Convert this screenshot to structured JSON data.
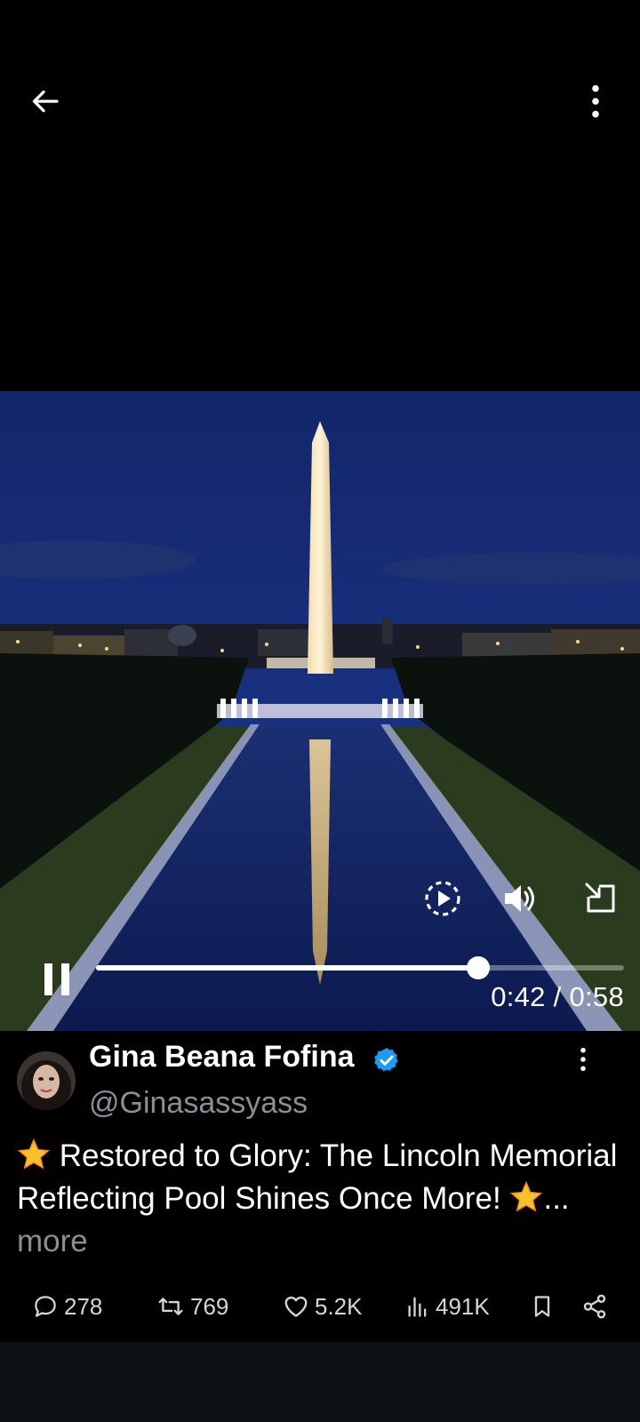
{
  "topbar": {
    "back_icon": "arrow-left-icon",
    "more_icon": "more-vertical-icon"
  },
  "video": {
    "current_time": "0:42",
    "duration": "0:58",
    "time_display": "0:42 / 0:58",
    "progress": 0.724,
    "controls": {
      "replay_icon": "replay-icon",
      "volume_icon": "volume-icon",
      "exit_fullscreen_icon": "exit-fullscreen-icon",
      "pause_icon": "pause-icon"
    }
  },
  "post": {
    "author": {
      "name": "Gina Beana Fofina",
      "handle": "@Ginasassyass",
      "verified": true
    },
    "text": "Restored to Glory: The Lincoln Memorial Reflecting Pool Shines Once More!",
    "ellipsis": "...",
    "more_label": "more",
    "stats": {
      "replies": "278",
      "reposts": "769",
      "likes": "5.2K",
      "views": "491K"
    }
  },
  "colors": {
    "background": "#000000",
    "muted_text": "#8b8f94",
    "verified_blue": "#1d9bf0",
    "star_yellow": "#fbc02d",
    "bottom_bar": "#0d1015"
  }
}
